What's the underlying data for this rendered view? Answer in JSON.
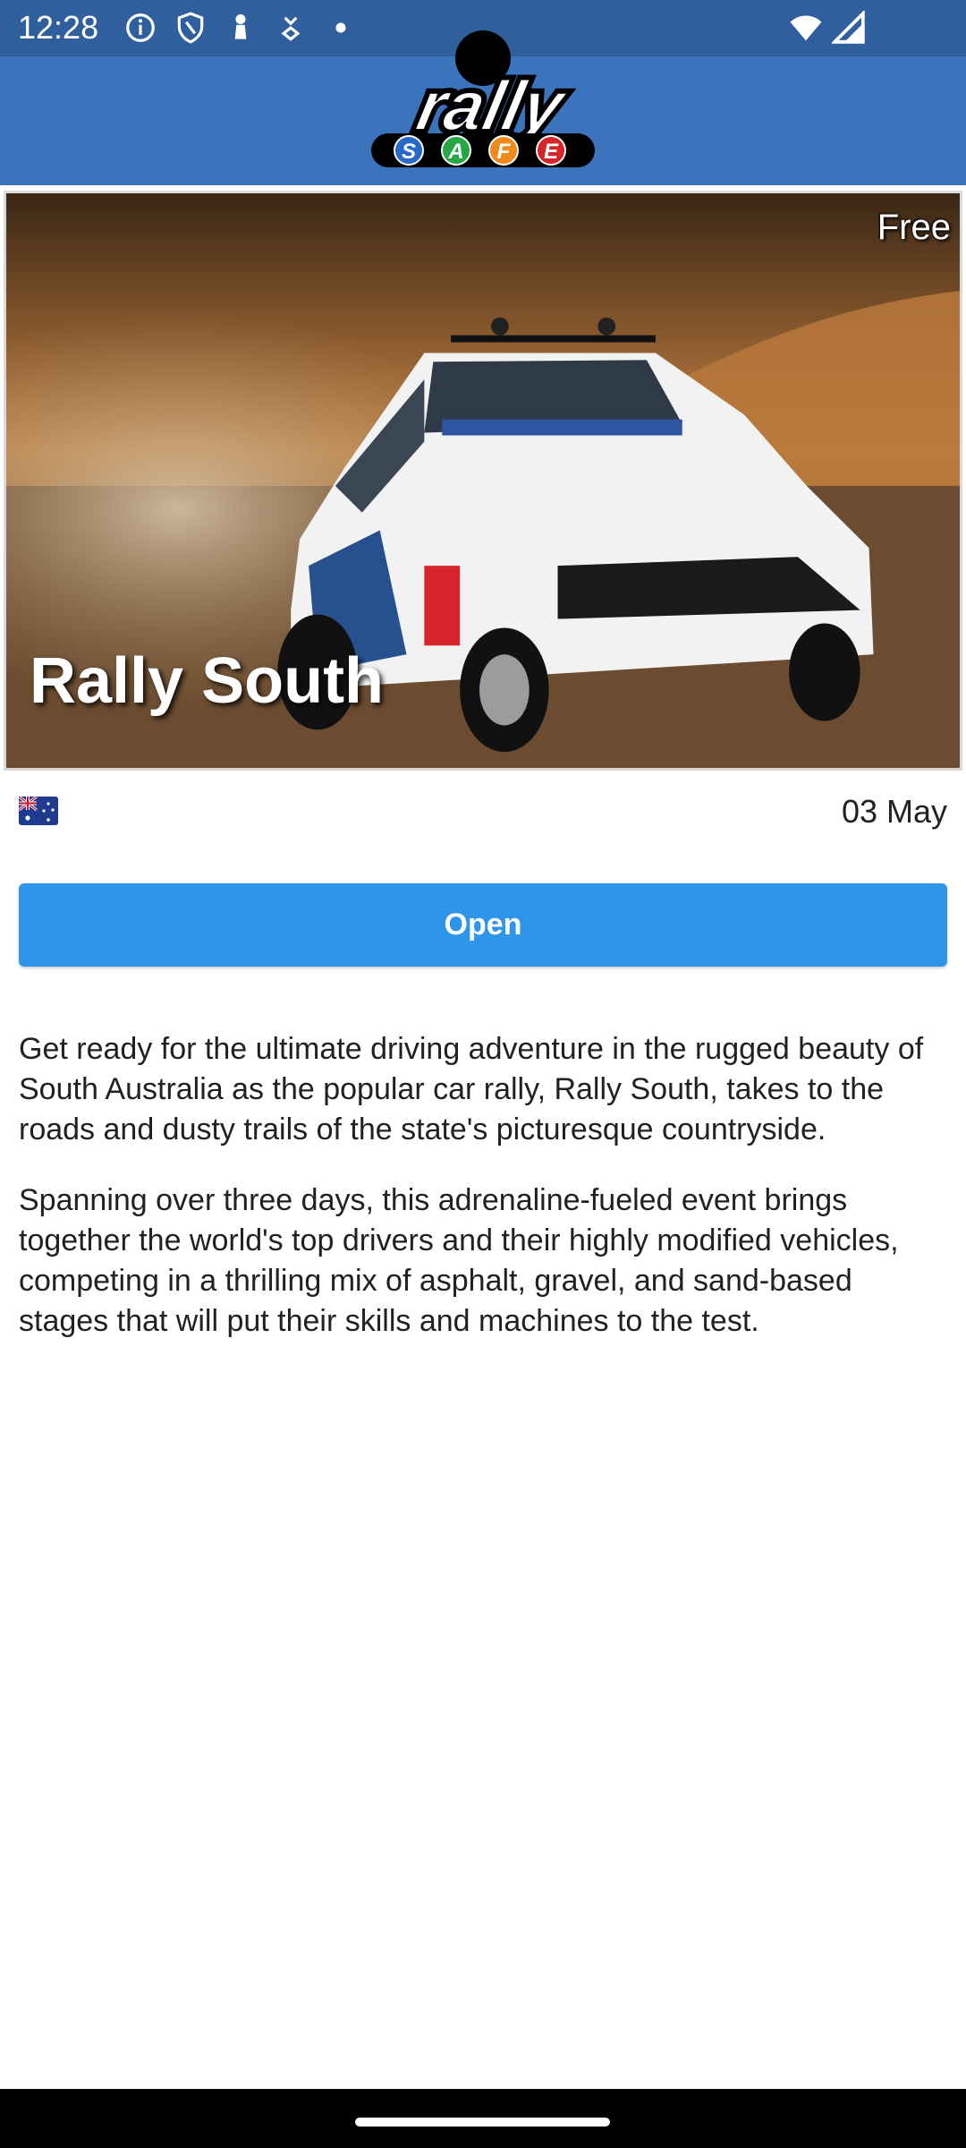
{
  "status_bar": {
    "time": "12:28",
    "icons_left": [
      "info-icon",
      "shield-icon",
      "chess-pawn-icon",
      "download-icon",
      "dot-icon"
    ],
    "icons_right": [
      "wifi-icon",
      "signal-icon"
    ]
  },
  "app_bar": {
    "logo_text": "rally",
    "logo_letters": [
      "S",
      "A",
      "F",
      "E"
    ]
  },
  "event": {
    "title": "Rally South",
    "price": "Free",
    "country_flag": "australia-flag-icon",
    "date": "03 May",
    "open_label": "Open",
    "description": [
      "Get ready for the ultimate driving adventure in the rugged beauty of South Australia as the popular car rally, Rally South, takes to the roads and dusty trails of the state's picturesque countryside.",
      "Spanning over three days, this adrenaline-fueled event brings together the world's top drivers and their highly modified vehicles, competing in a thrilling mix of asphalt, gravel, and sand-based stages that will put their skills and machines to the test."
    ]
  },
  "colors": {
    "status_bar": "#2f5f9d",
    "app_bar": "#3b74bd",
    "button": "#2f95ea"
  }
}
